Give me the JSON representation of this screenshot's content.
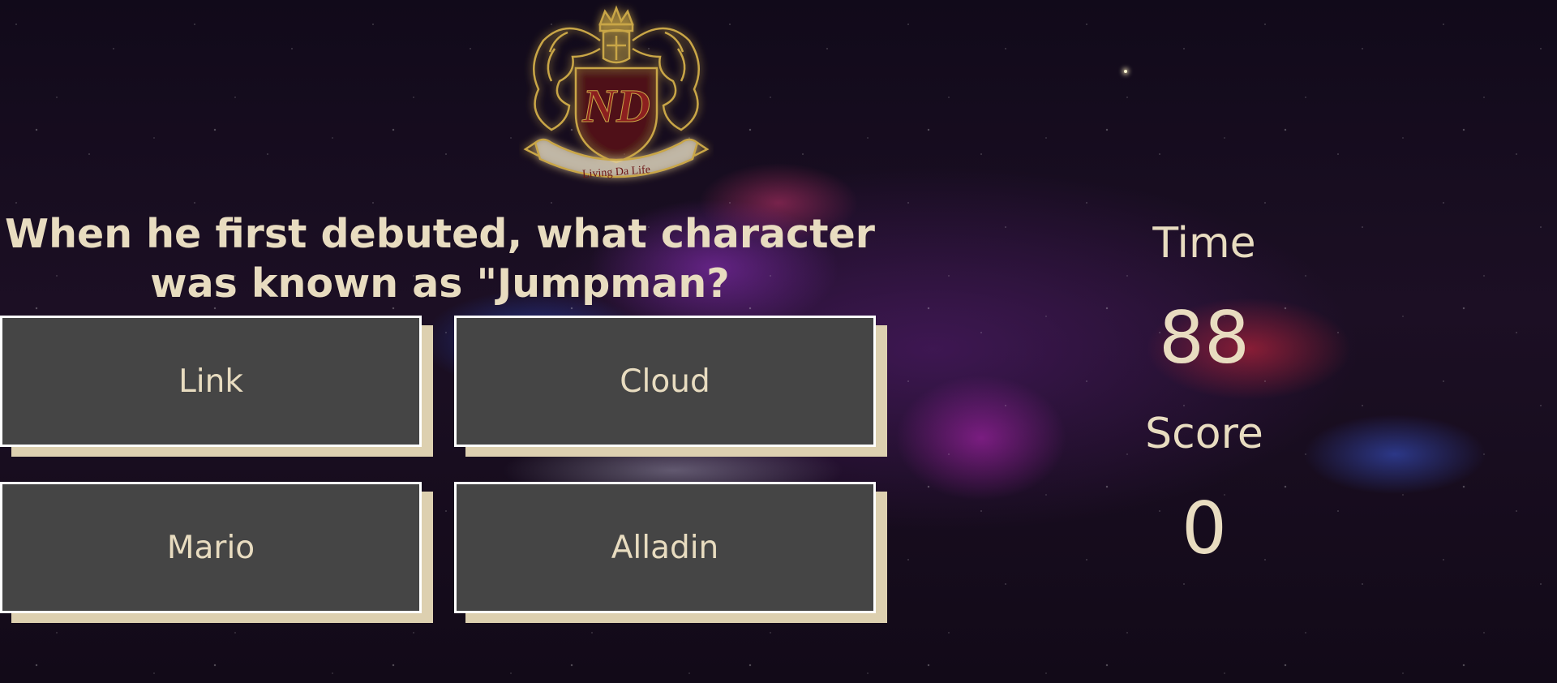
{
  "crest": {
    "monogram": "ND",
    "motto": "Living Da Life",
    "color": "#c9a646"
  },
  "question": {
    "text": "When he first debuted, what character was known as \"Jumpman?"
  },
  "answers": [
    {
      "label": "Link"
    },
    {
      "label": "Cloud"
    },
    {
      "label": "Mario"
    },
    {
      "label": "Alladin"
    }
  ],
  "stats": {
    "time_label": "Time",
    "time_value": "88",
    "score_label": "Score",
    "score_value": "0"
  },
  "colors": {
    "text": "#e8dcc0",
    "button_bg": "#454545",
    "button_shadow": "#ddd0b0"
  }
}
